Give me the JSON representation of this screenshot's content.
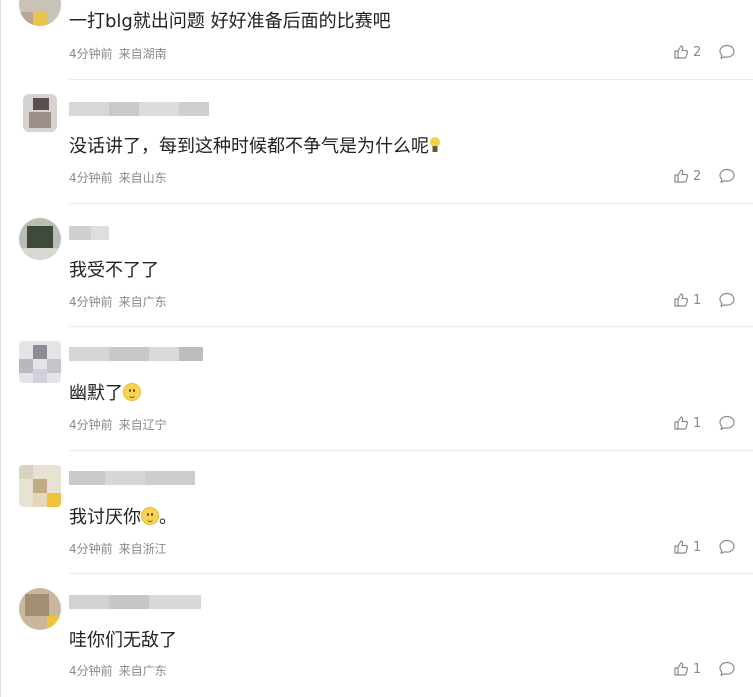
{
  "comments": [
    {
      "text": "一打blg就出问题 好好准备后面的比赛吧",
      "time": "4分钟前",
      "location": "来自湖南",
      "likes": "2",
      "emoji": ""
    },
    {
      "text": "没话讲了，每到这种时候都不争气是为什么呢",
      "time": "4分钟前",
      "location": "来自山东",
      "likes": "2",
      "emoji": "lightbulb-icon"
    },
    {
      "text": "我受不了了",
      "time": "4分钟前",
      "location": "来自广东",
      "likes": "1",
      "emoji": ""
    },
    {
      "text": "幽默了",
      "time": "4分钟前",
      "location": "来自辽宁",
      "likes": "1",
      "emoji": "smile-emoji-icon"
    },
    {
      "text": "我讨厌你",
      "text_after": "。",
      "time": "4分钟前",
      "location": "来自浙江",
      "likes": "1",
      "emoji": "smile-emoji-icon"
    },
    {
      "text": "哇你们无敌了",
      "time": "4分钟前",
      "location": "来自广东",
      "likes": "1",
      "emoji": ""
    }
  ],
  "icons": {
    "like": "thumbs-up-icon",
    "reply": "comment-bubble-icon"
  },
  "colors": {
    "text": "#222222",
    "meta": "#8a8a8a",
    "divider": "#ececec"
  }
}
